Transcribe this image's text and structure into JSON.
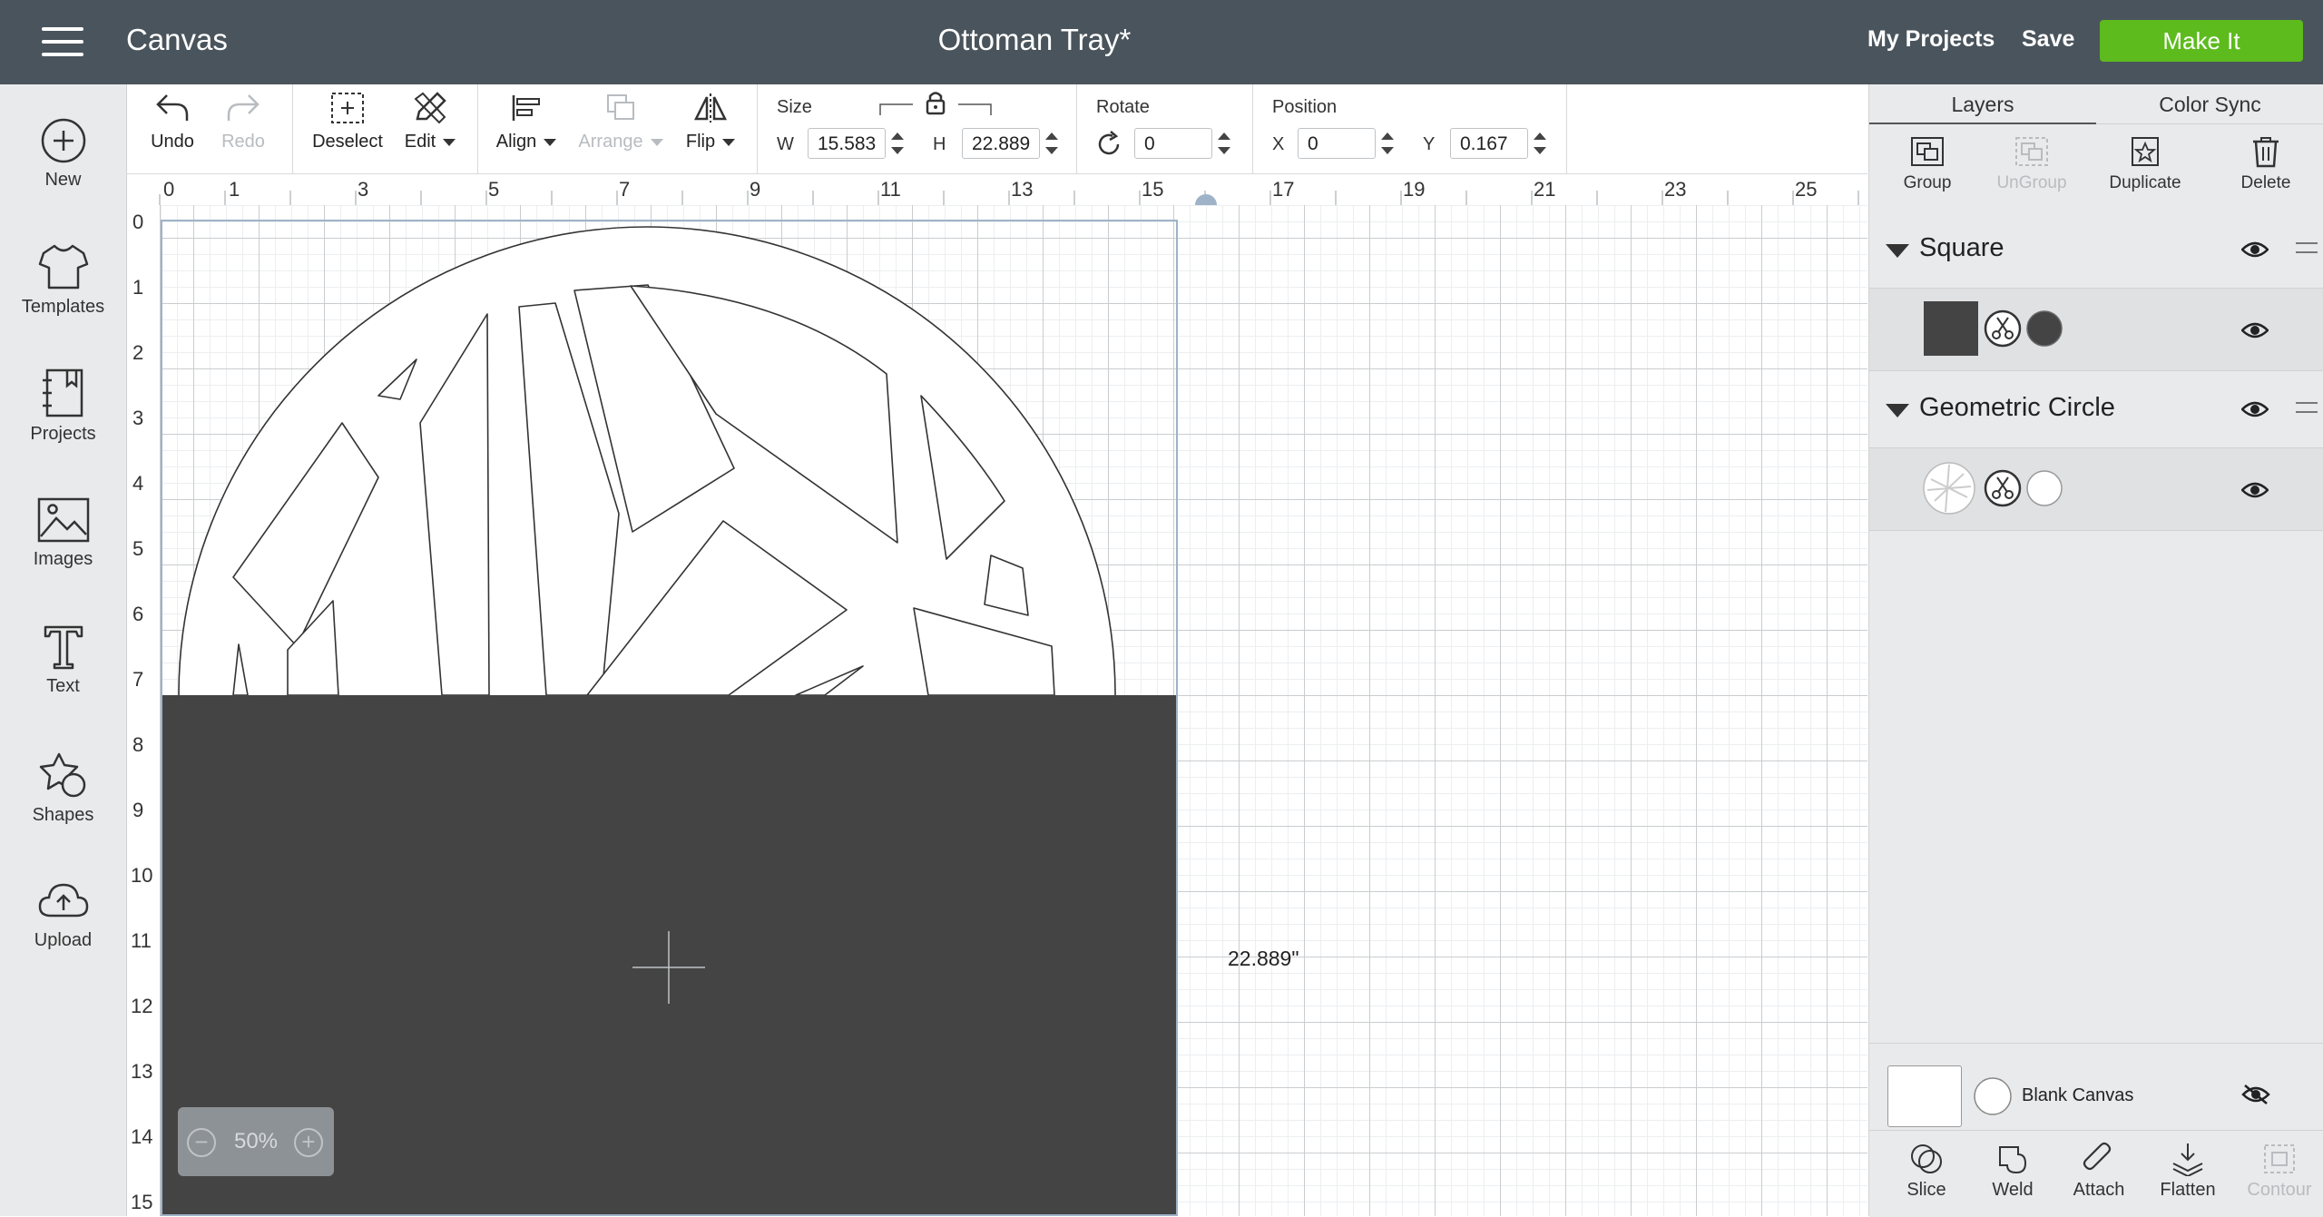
{
  "header": {
    "menu_icon": "hamburger-menu-icon",
    "app_title": "Canvas",
    "document_title": "Ottoman Tray*",
    "my_projects": "My Projects",
    "save": "Save",
    "make_it": "Make It",
    "make_it_color": "#5dbb1e",
    "bar_color": "#4a545c"
  },
  "sidebar": {
    "items": [
      {
        "label": "New",
        "icon": "plus-circle-icon"
      },
      {
        "label": "Templates",
        "icon": "tshirt-icon"
      },
      {
        "label": "Projects",
        "icon": "notebook-icon"
      },
      {
        "label": "Images",
        "icon": "image-icon"
      },
      {
        "label": "Text",
        "icon": "text-t-icon"
      },
      {
        "label": "Shapes",
        "icon": "shapes-icon"
      },
      {
        "label": "Upload",
        "icon": "cloud-upload-icon"
      }
    ]
  },
  "toolbar": {
    "undo": "Undo",
    "redo": "Redo",
    "deselect": "Deselect",
    "edit": "Edit",
    "align": "Align",
    "arrange": "Arrange",
    "flip": "Flip",
    "size_label": "Size",
    "w_label": "W",
    "w_value": "15.583",
    "h_label": "H",
    "h_value": "22.889",
    "rotate_label": "Rotate",
    "rotate_value": "0",
    "position_label": "Position",
    "x_label": "X",
    "x_value": "0",
    "y_label": "Y",
    "y_value": "0.167"
  },
  "ruler": {
    "horizontal": [
      "0",
      "1",
      "3",
      "5",
      "7",
      "9",
      "11",
      "13",
      "15",
      "17",
      "19",
      "21",
      "23",
      "25"
    ],
    "vertical": [
      "0",
      "1",
      "2",
      "3",
      "4",
      "5",
      "6",
      "7",
      "8",
      "9",
      "10",
      "11",
      "12",
      "13",
      "14",
      "15"
    ]
  },
  "canvas": {
    "dimension_label": "22.889\"",
    "zoom_value": "50%",
    "zoom_minus": "−",
    "zoom_plus": "+",
    "square_color": "#444444"
  },
  "right_panel": {
    "tabs": [
      "Layers",
      "Color Sync"
    ],
    "actions": [
      "Group",
      "UnGroup",
      "Duplicate",
      "Delete"
    ],
    "layers": [
      {
        "name": "Square",
        "swatch_color": "#444444"
      },
      {
        "name": "Geometric Circle",
        "swatch_color": "#ffffff"
      }
    ],
    "blank_canvas": "Blank Canvas",
    "bottom_actions": [
      "Slice",
      "Weld",
      "Attach",
      "Flatten",
      "Contour"
    ]
  }
}
